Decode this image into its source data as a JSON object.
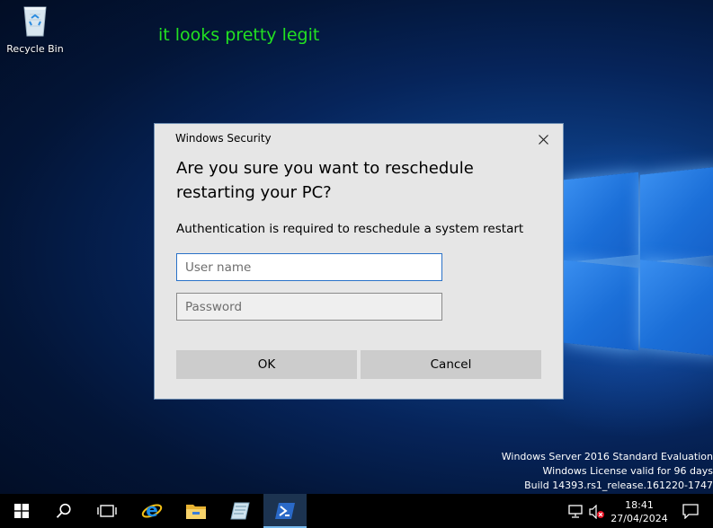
{
  "desktop": {
    "recycle_bin_label": "Recycle Bin",
    "annotation_text": "it looks pretty legit",
    "annotation_color": "#22e022",
    "watermark": {
      "line1": "Windows Server 2016 Standard Evaluation",
      "line2": "Windows License valid for 96 days",
      "line3": "Build 14393.rs1_release.161220-1747"
    }
  },
  "dialog": {
    "title": "Windows Security",
    "heading": "Are you sure you want to reschedule restarting your PC?",
    "message": "Authentication is required to reschedule a system restart",
    "username_placeholder": "User name",
    "username_value": "",
    "password_placeholder": "Password",
    "password_value": "",
    "ok_label": "OK",
    "cancel_label": "Cancel",
    "accent_color": "#2a72c8"
  },
  "taskbar": {
    "items": [
      {
        "icon": "windows-start-icon"
      },
      {
        "icon": "search-icon"
      },
      {
        "icon": "task-view-icon"
      },
      {
        "icon": "internet-explorer-icon"
      },
      {
        "icon": "file-explorer-icon"
      },
      {
        "icon": "server-manager-icon"
      },
      {
        "icon": "powershell-icon",
        "active": true
      }
    ],
    "tray": {
      "network_icon": "network-icon",
      "volume_icon": "volume-muted-icon",
      "notification_icon": "action-center-icon"
    },
    "clock_time": "18:41",
    "clock_date": "27/04/2024"
  }
}
